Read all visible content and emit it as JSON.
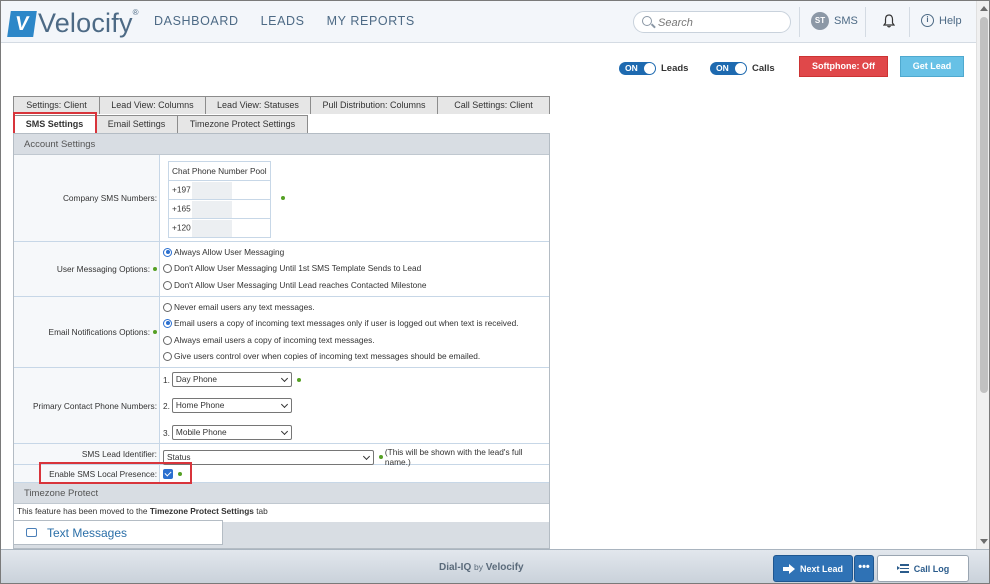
{
  "header": {
    "logo_text": "Velocify",
    "logo_mark": "V",
    "nav": [
      "DASHBOARD",
      "LEADS",
      "MY REPORTS"
    ],
    "search_placeholder": "Search",
    "user_initials": "ST",
    "user_label": "SMS",
    "help_label": "Help"
  },
  "controls": {
    "leads_toggle": {
      "state": "ON",
      "label": "Leads"
    },
    "calls_toggle": {
      "state": "ON",
      "label": "Calls"
    },
    "softphone_label": "Softphone: Off",
    "get_lead_label": "Get Lead",
    "softphone_color": "#e0484a",
    "get_lead_color": "#67c1e6"
  },
  "tabs_row1": [
    "Settings: Client",
    "Lead View: Columns",
    "Lead View: Statuses",
    "Pull Distribution: Columns",
    "Call Settings: Client"
  ],
  "tabs_row2": [
    "SMS Settings",
    "Email Settings",
    "Timezone Protect Settings"
  ],
  "active_tab": "SMS Settings",
  "account_settings": {
    "header": "Account Settings",
    "company_sms": {
      "label": "Company SMS Numbers:",
      "pool_header": "Chat Phone Number Pool",
      "numbers": [
        "+197",
        "+165",
        "+120"
      ]
    },
    "user_messaging": {
      "label": "User Messaging Options:",
      "options": [
        "Always Allow User Messaging",
        "Don't Allow User Messaging Until 1st SMS Template Sends to Lead",
        "Don't Allow User Messaging Until Lead reaches Contacted Milestone"
      ],
      "selected_index": 0
    },
    "email_notifications": {
      "label": "Email Notifications Options:",
      "options": [
        "Never email users any text messages.",
        "Email users a copy of incoming text messages only if user is logged out when text is received.",
        "Always email users a copy of incoming text messages.",
        "Give users control over when copies of incoming text messages should be emailed."
      ],
      "selected_index": 1
    },
    "primary_contact": {
      "label": "Primary Contact Phone Numbers:",
      "items": [
        {
          "num": "1.",
          "value": "Day Phone"
        },
        {
          "num": "2.",
          "value": "Home Phone"
        },
        {
          "num": "3.",
          "value": "Mobile Phone"
        }
      ]
    },
    "lead_identifier": {
      "label": "SMS Lead Identifier:",
      "value": "Status",
      "note": "(This will be shown with the lead's full name.)"
    },
    "local_presence": {
      "label": "Enable SMS Local Presence:",
      "checked": true
    }
  },
  "timezone_protect": {
    "header": "Timezone Protect",
    "note_prefix": "This feature has been moved to the",
    "note_link": "Timezone Protect Settings",
    "note_suffix": "tab"
  },
  "text_messages_label": "Text Messages",
  "footer": {
    "brand": "Dial-IQ",
    "by": "by",
    "brand2": "Velocify",
    "next_lead": "Next Lead",
    "more": "•••",
    "call_log": "Call Log"
  }
}
